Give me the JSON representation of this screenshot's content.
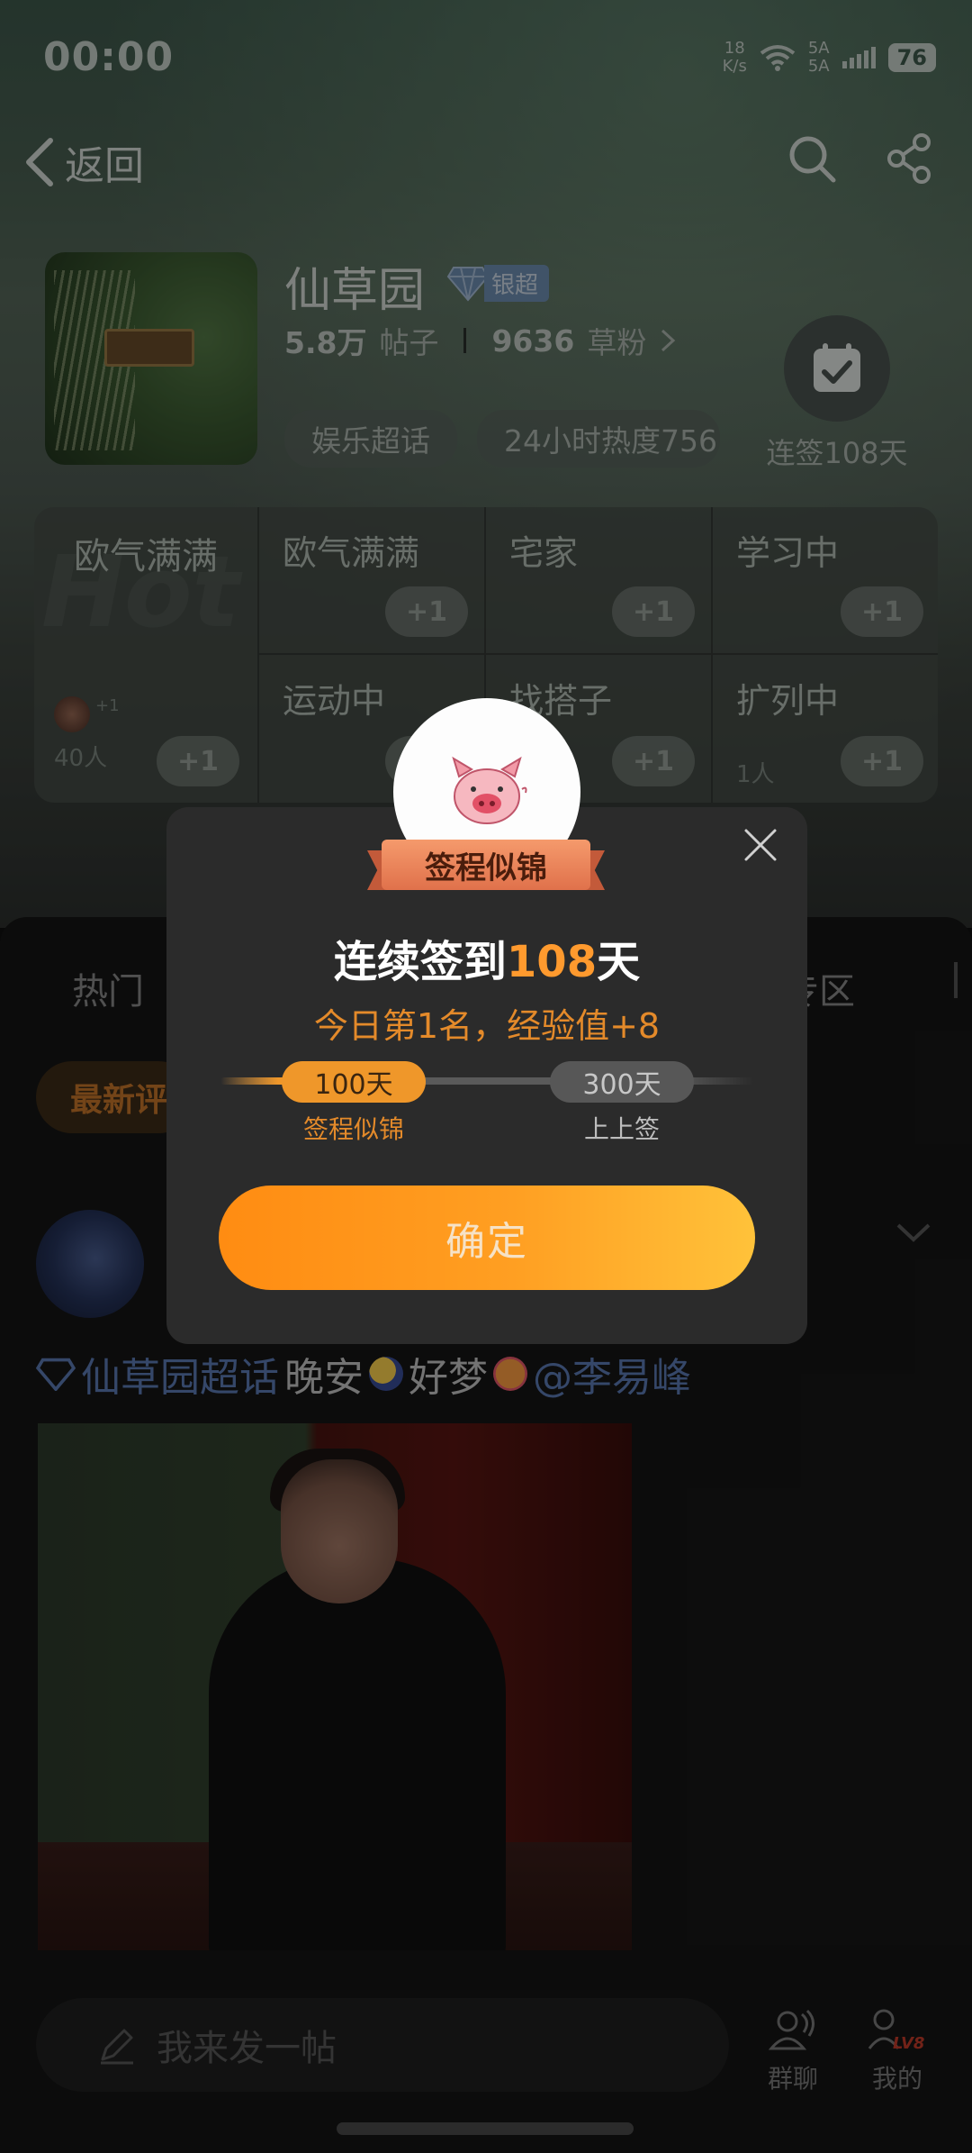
{
  "status_bar": {
    "time": "00:00",
    "net_speed_value": "18",
    "net_speed_unit": "K/s",
    "sim1": "5A",
    "sim2": "5A",
    "battery": "76"
  },
  "nav": {
    "back_label": "返回"
  },
  "topic": {
    "title": "仙草园",
    "level_badge": "银超",
    "posts_count": "5.8万",
    "posts_label": "帖子",
    "fans_count": "9636",
    "fans_label": "草粉",
    "tags": [
      "娱乐超话",
      "24小时热度756"
    ]
  },
  "checkin": {
    "label": "连签108天"
  },
  "mood_grid": {
    "featured": {
      "name": "欧气满满",
      "people": "40人",
      "plus": "+1",
      "mini_plus": "+1"
    },
    "cells": [
      {
        "name": "欧气满满",
        "people": "",
        "plus": "+1"
      },
      {
        "name": "宅家",
        "people": "",
        "plus": "+1"
      },
      {
        "name": "学习中",
        "people": "",
        "plus": "+1"
      },
      {
        "name": "运动中",
        "people": "",
        "plus": "+1"
      },
      {
        "name": "找搭子",
        "people": "",
        "plus": "+1"
      },
      {
        "name": "扩列中",
        "people": "1人",
        "plus": "+1"
      }
    ]
  },
  "content": {
    "tab_hot": "热门",
    "tab_zone": "专区",
    "filter_chip": "最新评",
    "post": {
      "topic_link": "仙草园超话",
      "text_1": "晚安",
      "text_2": "好梦",
      "mention": "@李易峰"
    }
  },
  "bottom_bar": {
    "compose_placeholder": "我来发一帖",
    "group_chat_label": "群聊",
    "mine_label": "我的",
    "mine_level": "LV8"
  },
  "dialog": {
    "badge_title": "签程似锦",
    "title_prefix": "连续签到",
    "title_days": "108",
    "title_suffix": "天",
    "subtitle": "今日第1名，经验值+8",
    "milestones": [
      {
        "days": "100天",
        "name": "签程似锦"
      },
      {
        "days": "300天",
        "name": "上上签"
      }
    ],
    "progress_fraction": 0.27,
    "confirm_label": "确定"
  },
  "colors": {
    "accent_orange": "#ff9a2e",
    "link_blue": "#5c7bb5",
    "ribbon": "#e0714b"
  }
}
